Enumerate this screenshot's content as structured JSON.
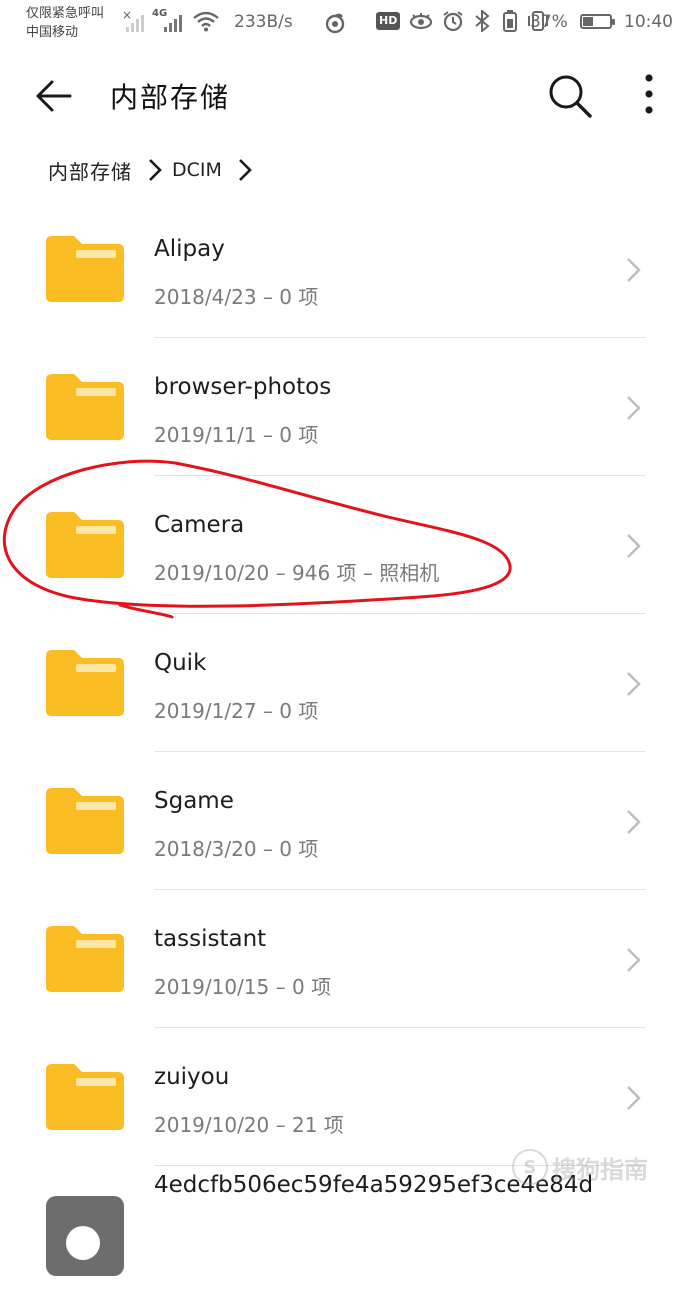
{
  "status_bar": {
    "carrier_line1": "仅限紧急呼叫",
    "carrier_line2": "中国移动",
    "network_type": "4G",
    "net_speed": "233B/s",
    "hd_badge": "HD",
    "battery_percent": "37%",
    "battery_level": 0.37,
    "time": "10:40"
  },
  "app_bar": {
    "title": "内部存储"
  },
  "breadcrumb": {
    "root": "内部存储",
    "current": "DCIM"
  },
  "files": [
    {
      "name": "Alipay",
      "meta": "2018/4/23 – 0 项"
    },
    {
      "name": "browser-photos",
      "meta": "2019/11/1 – 0 项"
    },
    {
      "name": "Camera",
      "meta": "2019/10/20 – 946 项 – 照相机"
    },
    {
      "name": "Quik",
      "meta": "2019/1/27 – 0 项"
    },
    {
      "name": "Sgame",
      "meta": "2018/3/20 – 0 项"
    },
    {
      "name": "tassistant",
      "meta": "2019/10/15 – 0 项"
    },
    {
      "name": "zuiyou",
      "meta": "2019/10/20 – 21 项"
    },
    {
      "name": "4edcfb506ec59fe4a59295ef3ce4e84d",
      "meta": ""
    }
  ],
  "watermark": {
    "text": "搜狗指南"
  },
  "colors": {
    "folder_yellow": "#fbbd24",
    "folder_tab": "#fde7a6",
    "annotation_red": "#e3131b"
  }
}
